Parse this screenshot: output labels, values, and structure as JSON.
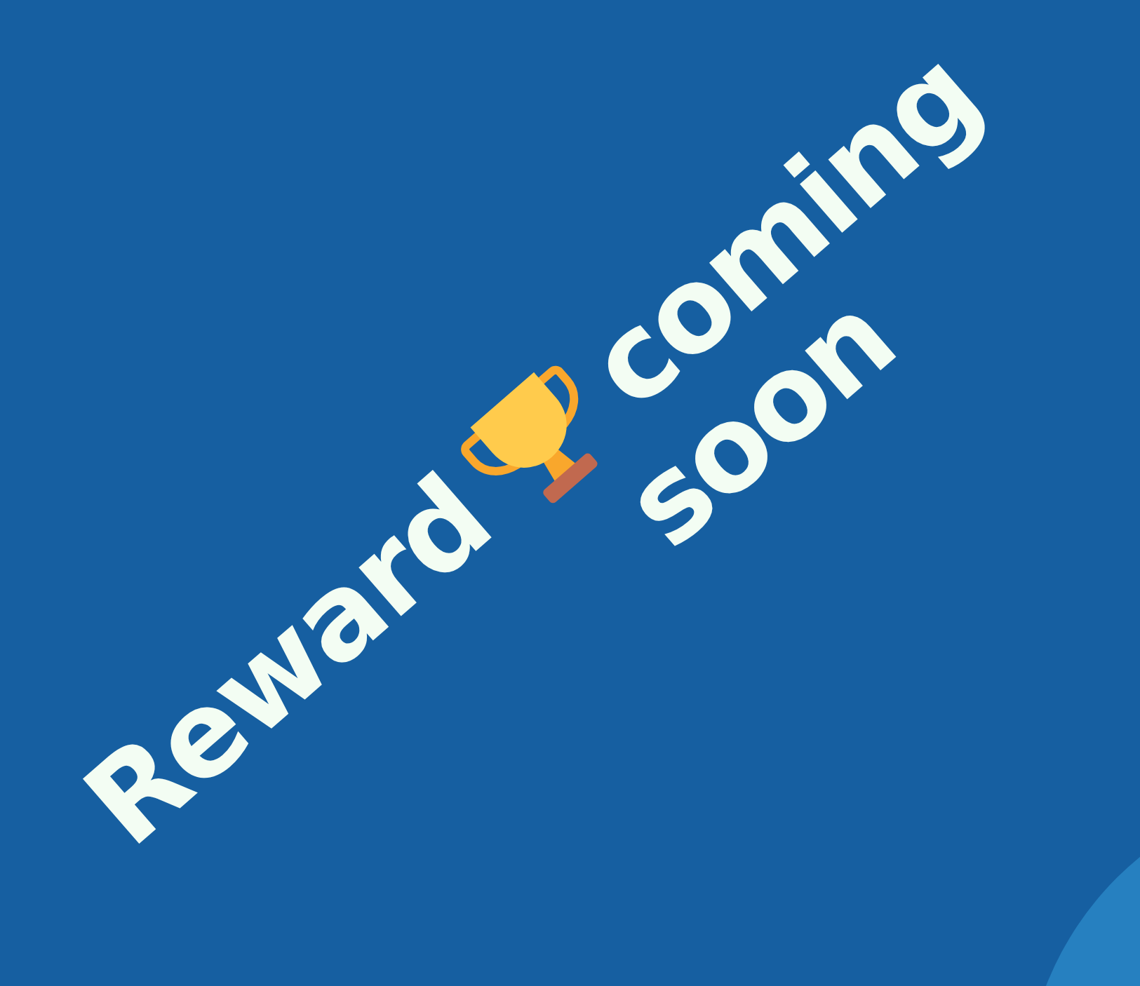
{
  "banner": {
    "text_before_icon": "Reward",
    "text_after_icon": "coming",
    "second_line": "soon"
  }
}
